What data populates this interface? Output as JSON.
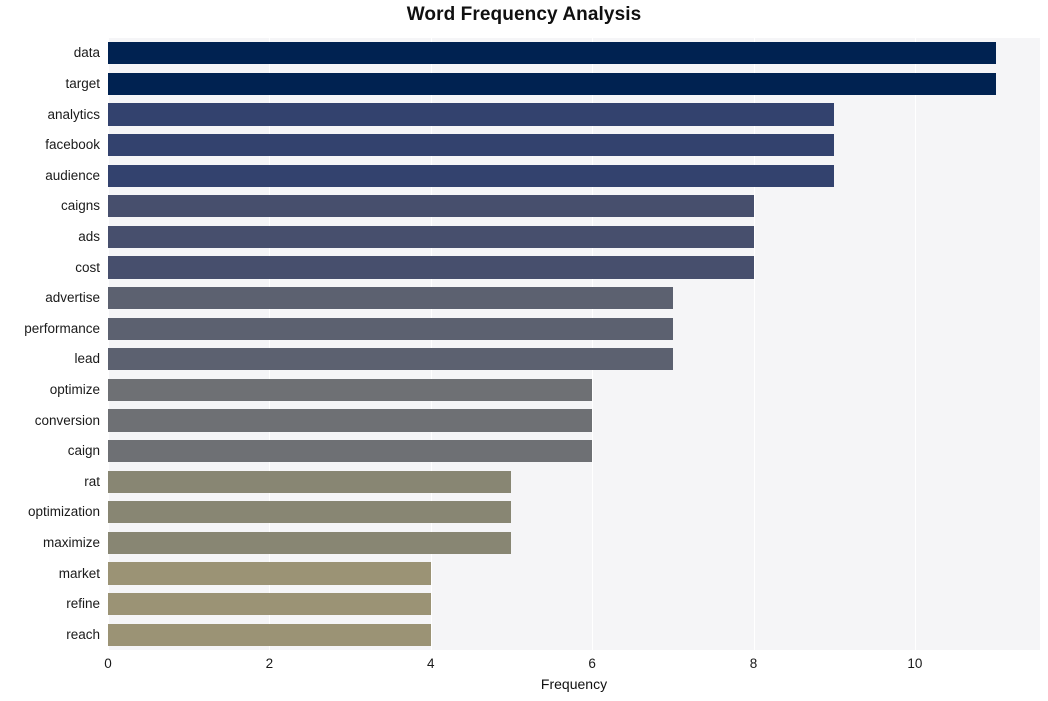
{
  "chart_data": {
    "type": "bar",
    "orientation": "horizontal",
    "title": "Word Frequency Analysis",
    "xlabel": "Frequency",
    "ylabel": "",
    "categories": [
      "data",
      "target",
      "analytics",
      "facebook",
      "audience",
      "caigns",
      "ads",
      "cost",
      "advertise",
      "performance",
      "lead",
      "optimize",
      "conversion",
      "caign",
      "rat",
      "optimization",
      "maximize",
      "market",
      "refine",
      "reach"
    ],
    "values": [
      11,
      11,
      9,
      9,
      9,
      8,
      8,
      8,
      7,
      7,
      7,
      6,
      6,
      6,
      5,
      5,
      5,
      4,
      4,
      4
    ],
    "bar_colors": [
      "#002251",
      "#002251",
      "#33426e",
      "#33426e",
      "#33426e",
      "#474f6d",
      "#474f6d",
      "#474f6d",
      "#5c6170",
      "#5c6170",
      "#5c6170",
      "#6e7074",
      "#6e7074",
      "#6e7074",
      "#888673",
      "#888673",
      "#888673",
      "#9b9375",
      "#9b9375",
      "#9b9375"
    ],
    "xlim": [
      0,
      11.55
    ],
    "xticks": [
      0,
      2,
      4,
      6,
      8,
      10
    ],
    "xticklabels": [
      "0",
      "2",
      "4",
      "6",
      "8",
      "10"
    ],
    "grid": true,
    "grid_axis": "x",
    "grid_color": "#ffffff",
    "plot_background": "#f5f5f7",
    "figure_background": "#ffffff",
    "legend": null
  }
}
